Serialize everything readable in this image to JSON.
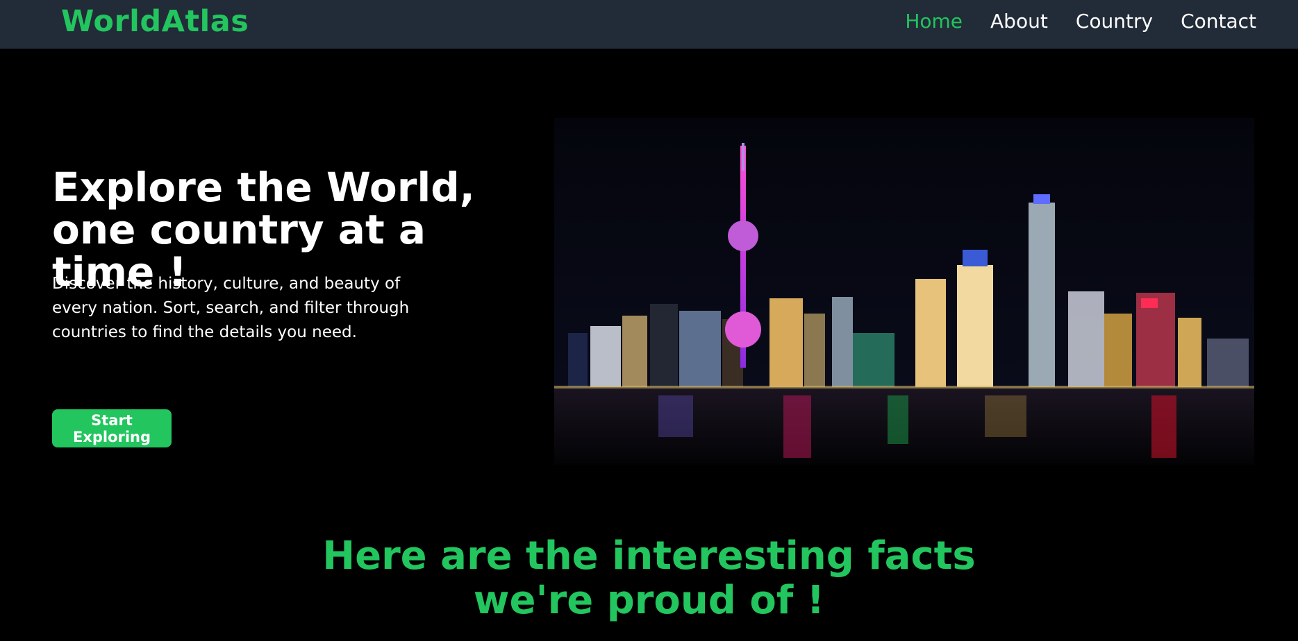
{
  "nav": {
    "logo": "WorldAtlas",
    "links": [
      {
        "label": "Home",
        "active": true
      },
      {
        "label": "About",
        "active": false
      },
      {
        "label": "Country",
        "active": false
      },
      {
        "label": "Contact",
        "active": false
      }
    ]
  },
  "hero": {
    "title": "Explore the World, one country at a time !",
    "description": "Discover the history, culture, and beauty of every nation. Sort, search, and filter through countries to find the details you need.",
    "cta_label": "Start Exploring",
    "image_label": "Shanghai skyline at night"
  },
  "facts": {
    "heading_line1": "Here are the interesting facts",
    "heading_line2": "we're proud of !"
  },
  "colors": {
    "accent": "#22c55e",
    "navbar_bg": "#222b38",
    "page_bg": "#000000"
  }
}
